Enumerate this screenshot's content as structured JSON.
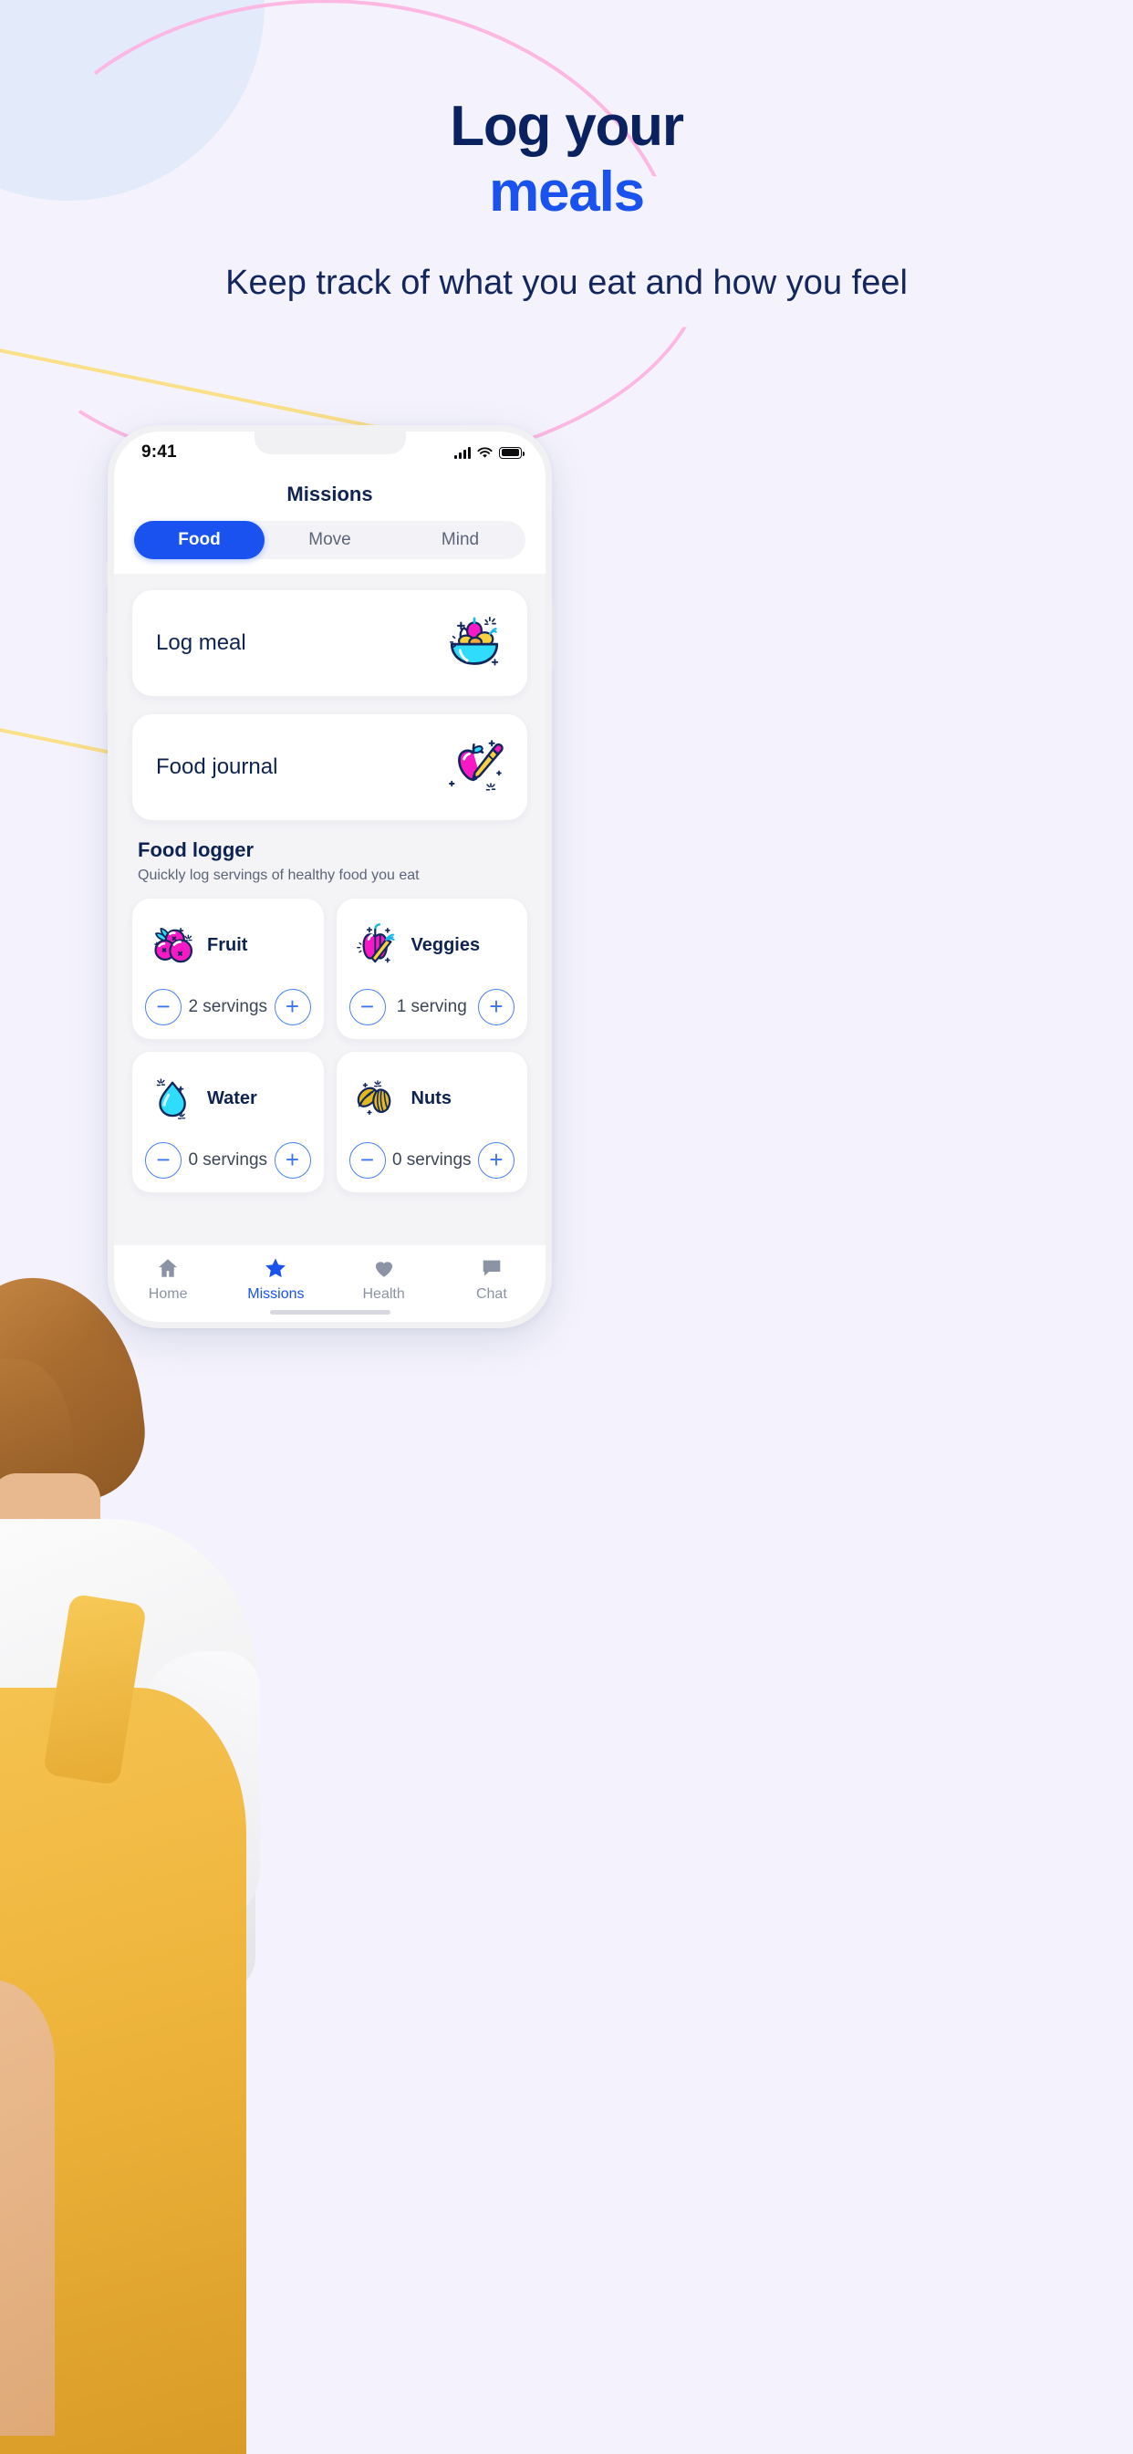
{
  "hero": {
    "title_line1": "Log your",
    "title_line2": "meals",
    "subtitle": "Keep track of what you eat and how you feel",
    "title_color": "#0a2260",
    "accent_color": "#1a52f0",
    "background_color": "#f4f3fd"
  },
  "phone": {
    "status_bar": {
      "time": "9:41",
      "signal_icon": "cellular-signal-icon",
      "wifi_icon": "wifi-icon",
      "battery_icon": "battery-full-icon"
    },
    "header": {
      "title": "Missions",
      "tabs": [
        {
          "label": "Food",
          "active": true
        },
        {
          "label": "Move",
          "active": false
        },
        {
          "label": "Mind",
          "active": false
        }
      ]
    },
    "action_cards": [
      {
        "label": "Log meal",
        "icon": "salad-bowl-icon"
      },
      {
        "label": "Food journal",
        "icon": "apple-pencil-icon"
      }
    ],
    "food_logger": {
      "title": "Food logger",
      "subtitle": "Quickly log servings of healthy food you eat",
      "items": [
        {
          "name": "Fruit",
          "icon": "berries-icon",
          "value": "2 servings",
          "minus": "−",
          "plus": "+"
        },
        {
          "name": "Veggies",
          "icon": "pepper-carrot-icon",
          "value": "1 serving",
          "minus": "−",
          "plus": "+"
        },
        {
          "name": "Water",
          "icon": "water-drop-icon",
          "value": "0 servings",
          "minus": "−",
          "plus": "+"
        },
        {
          "name": "Nuts",
          "icon": "almonds-icon",
          "value": "0 servings",
          "minus": "−",
          "plus": "+"
        }
      ]
    },
    "bottom_nav": [
      {
        "label": "Home",
        "icon": "home-icon",
        "active": false
      },
      {
        "label": "Missions",
        "icon": "star-icon",
        "active": true
      },
      {
        "label": "Health",
        "icon": "heart-icon",
        "active": false
      },
      {
        "label": "Chat",
        "icon": "chat-bubble-icon",
        "active": false
      }
    ],
    "colors": {
      "accent_blue": "#1a52f0",
      "inactive_gray": "#8b93a5",
      "card_white": "#ffffff",
      "app_bg": "#f4f4f7",
      "text_navy": "#0f2350"
    }
  },
  "decor": {
    "yellow_stripe_color": "#fbe08a",
    "pink_curve_color": "#fcb8e2",
    "blob_color": "#e3ebfa"
  }
}
